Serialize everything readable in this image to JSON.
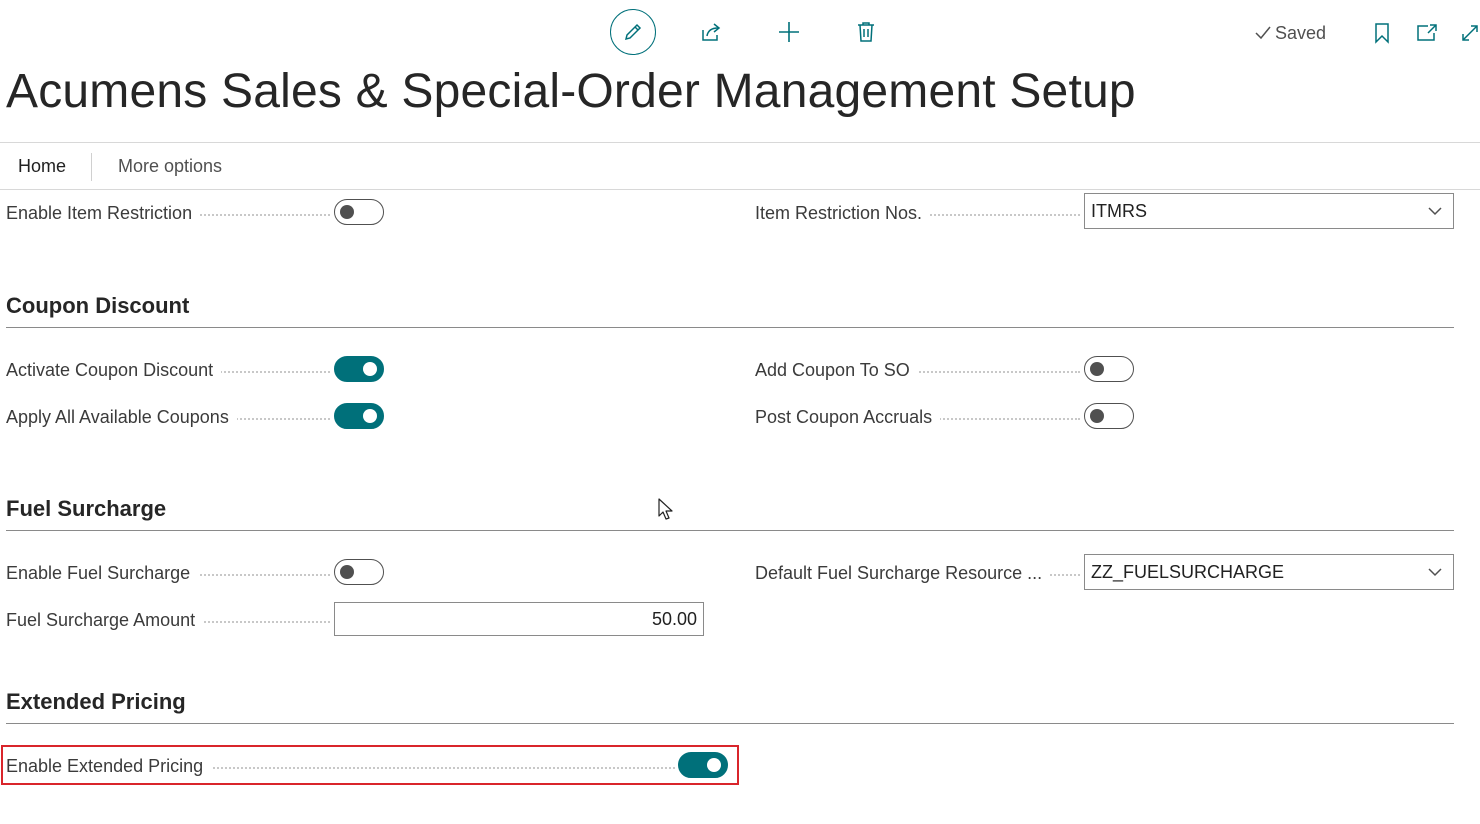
{
  "toolbar": {
    "edit_icon": "pencil-icon",
    "share_icon": "share-icon",
    "new_icon": "plus-icon",
    "delete_icon": "trash-icon",
    "saved_label": "Saved",
    "bookmark_icon": "bookmark-icon",
    "popout_icon": "popout-icon",
    "expand_icon": "expand-icon"
  },
  "page": {
    "title": "Acumens Sales & Special-Order Management Setup"
  },
  "actionbar": {
    "home": "Home",
    "more": "More options"
  },
  "general": {
    "enable_item_restriction": {
      "label": "Enable Item Restriction",
      "value": false
    },
    "item_restriction_nos": {
      "label": "Item Restriction Nos.",
      "value": "ITMRS"
    }
  },
  "coupon": {
    "title": "Coupon Discount",
    "activate": {
      "label": "Activate Coupon Discount",
      "value": true
    },
    "apply_all": {
      "label": "Apply All Available Coupons",
      "value": true
    },
    "add_to_so": {
      "label": "Add Coupon To SO",
      "value": false
    },
    "post_accruals": {
      "label": "Post Coupon Accruals",
      "value": false
    }
  },
  "fuel": {
    "title": "Fuel Surcharge",
    "enable": {
      "label": "Enable Fuel Surcharge",
      "value": false
    },
    "amount": {
      "label": "Fuel Surcharge Amount",
      "value": "50.00"
    },
    "default_resource": {
      "label": "Default Fuel Surcharge Resource ...",
      "value": "ZZ_FUELSURCHARGE"
    }
  },
  "pricing": {
    "title": "Extended Pricing",
    "enable": {
      "label": "Enable Extended Pricing",
      "value": true
    }
  },
  "colors": {
    "accent": "#00707a",
    "highlight": "#d9252b"
  }
}
